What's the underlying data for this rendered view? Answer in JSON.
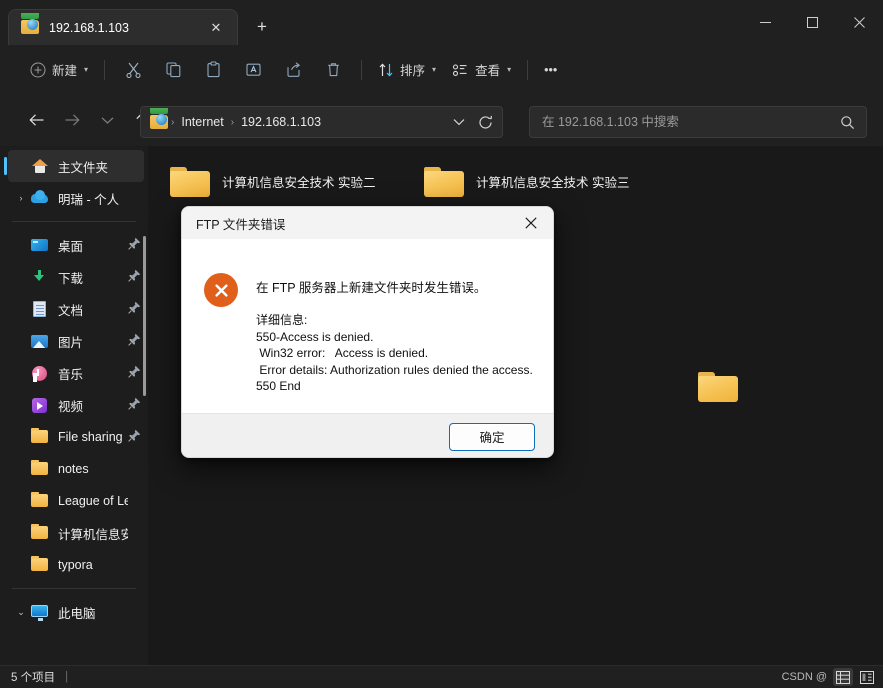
{
  "window": {
    "tab_title": "192.168.1.103",
    "tab_icon": "ftp-folder-globe-icon",
    "new_tab_label": "+",
    "minimize_label": "—",
    "maximize_label": "☐",
    "close_label": "✕",
    "tab_close_label": "✕"
  },
  "toolbar": {
    "new_label": "新建",
    "sort_label": "排序",
    "view_label": "查看",
    "more_label": "•••",
    "chevron": "⌵",
    "icons": [
      {
        "name": "cut-icon",
        "title": "剪切"
      },
      {
        "name": "copy-icon",
        "title": "复制"
      },
      {
        "name": "paste-icon",
        "title": "粘贴"
      },
      {
        "name": "rename-icon",
        "title": "重命名"
      },
      {
        "name": "share-icon",
        "title": "共享"
      },
      {
        "name": "delete-icon",
        "title": "删除"
      }
    ]
  },
  "nav": {
    "back_label": "←",
    "forward_label": "→",
    "recent_label": "⌵",
    "up_label": "↑",
    "refresh_label": "↻",
    "dropdown_label": "⌵"
  },
  "breadcrumb": {
    "icon": "ftp-folder-globe-icon",
    "items": [
      "Internet",
      "192.168.1.103"
    ],
    "separator": "›"
  },
  "search": {
    "placeholder": "在 192.168.1.103 中搜索",
    "value": "",
    "icon": "search-icon"
  },
  "sidebar": {
    "items": [
      {
        "label": "主文件夹",
        "icon": "home-icon",
        "selected": true,
        "expander": "",
        "pinned": false
      },
      {
        "label": "明瑞 - 个人",
        "icon": "onedrive-cloud-icon",
        "selected": false,
        "expander": "›",
        "pinned": false
      },
      {
        "divider": true
      },
      {
        "label": "桌面",
        "icon": "desktop-icon",
        "selected": false,
        "expander": "",
        "pinned": true
      },
      {
        "label": "下载",
        "icon": "downloads-icon",
        "selected": false,
        "expander": "",
        "pinned": true
      },
      {
        "label": "文档",
        "icon": "documents-icon",
        "selected": false,
        "expander": "",
        "pinned": true
      },
      {
        "label": "图片",
        "icon": "pictures-icon",
        "selected": false,
        "expander": "",
        "pinned": true
      },
      {
        "label": "音乐",
        "icon": "music-icon",
        "selected": false,
        "expander": "",
        "pinned": true
      },
      {
        "label": "视频",
        "icon": "videos-icon",
        "selected": false,
        "expander": "",
        "pinned": true
      },
      {
        "label": "File sharing",
        "icon": "folder-icon",
        "selected": false,
        "expander": "",
        "pinned": true
      },
      {
        "label": "notes",
        "icon": "folder-icon",
        "selected": false,
        "expander": "",
        "pinned": false
      },
      {
        "label": "League of Leg",
        "icon": "folder-icon",
        "selected": false,
        "expander": "",
        "pinned": false
      },
      {
        "label": "计算机信息安全",
        "icon": "folder-icon",
        "selected": false,
        "expander": "",
        "pinned": false
      },
      {
        "label": "typora",
        "icon": "folder-icon",
        "selected": false,
        "expander": "",
        "pinned": false
      },
      {
        "divider": true
      },
      {
        "label": "此电脑",
        "icon": "this-pc-icon",
        "selected": false,
        "expander": "⌄",
        "pinned": false
      }
    ],
    "pin_glyph": "📌"
  },
  "content": {
    "folders": [
      {
        "name": "计算机信息安全技术 实验二"
      },
      {
        "name": "计算机信息安全技术 实验三"
      }
    ]
  },
  "dialog": {
    "title": "FTP 文件夹错误",
    "close_label": "✕",
    "error_glyph": "✕",
    "message": "在 FTP 服务器上新建文件夹时发生错误。",
    "detail_heading": "详细信息:",
    "detail_lines": [
      "550-Access is denied.",
      " Win32 error:   Access is denied.",
      " Error details: Authorization rules denied the access.",
      "550 End"
    ],
    "ok_label": "确定"
  },
  "statusbar": {
    "item_count": "5 个项目",
    "separator": "|",
    "watermark": "CSDN @",
    "view_details_icon": "details-view-icon",
    "view_large_icon": "large-icons-view-icon"
  },
  "colors": {
    "accent": "#4cc2ff",
    "window_bg": "#202020",
    "content_bg": "#191919",
    "sidebar_bg": "#1d1d1d",
    "dialog_bg": "#ffffff",
    "dialog_footer": "#f0f0f0",
    "error_red": "#e0601b",
    "folder_yellow": "#f7c559",
    "button_border": "#0f6cbd"
  }
}
